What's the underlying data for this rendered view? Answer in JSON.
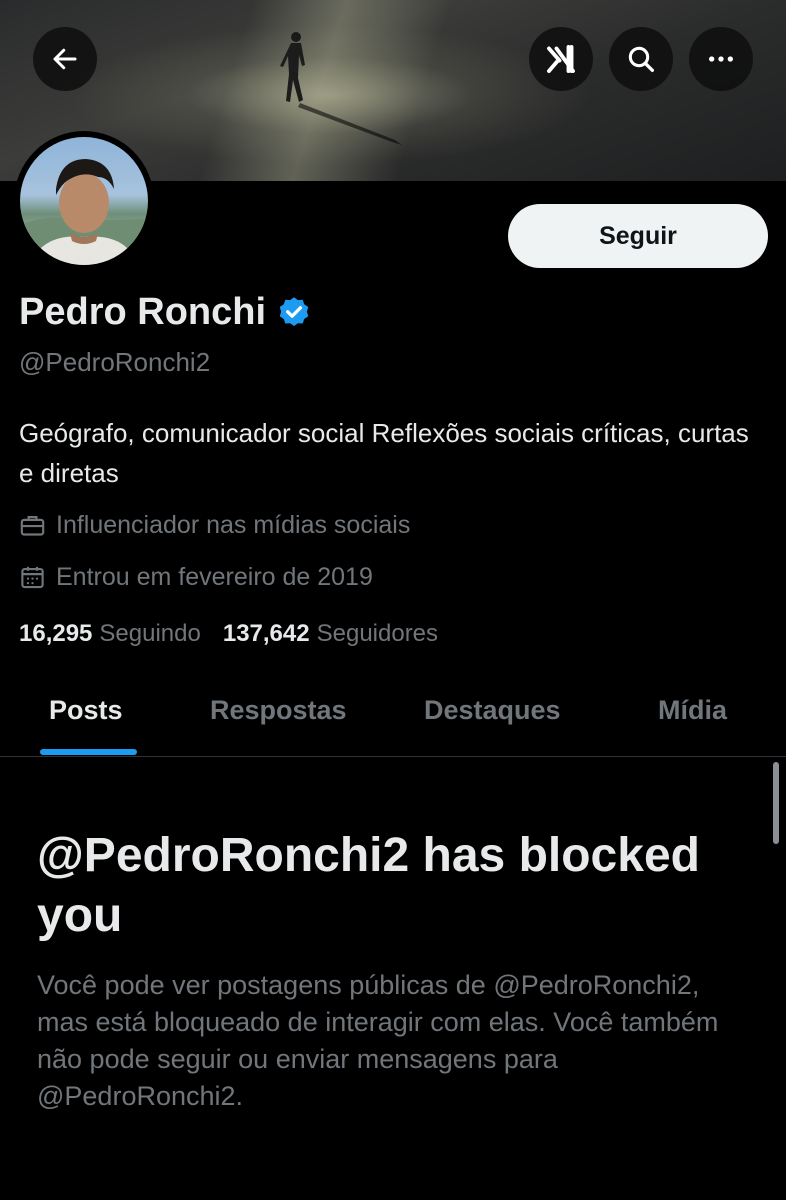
{
  "header": {
    "back_icon": "arrow-left-icon",
    "grok_icon": "grok-icon",
    "search_icon": "search-icon",
    "more_icon": "more-horizontal-icon"
  },
  "profile": {
    "follow_label": "Seguir",
    "name": "Pedro Ronchi",
    "verified_icon": "verified-badge-icon",
    "verified_color": "#1d9bf0",
    "handle": "@PedroRonchi2",
    "bio": "Geógrafo, comunicador social Reflexões sociais críticas, curtas e diretas",
    "category": "Influenciador nas mídias sociais",
    "joined": "Entrou em fevereiro de 2019",
    "following_count": "16,295",
    "following_label": "Seguindo",
    "followers_count": "137,642",
    "followers_label": "Seguidores"
  },
  "tabs": [
    {
      "label": "Posts",
      "active": true
    },
    {
      "label": "Respostas",
      "active": false
    },
    {
      "label": "Destaques",
      "active": false
    },
    {
      "label": "Mídia",
      "active": false
    }
  ],
  "blocked": {
    "title": "@PedroRonchi2 has blocked you",
    "description": "Você pode ver postagens públicas de @PedroRonchi2, mas está bloqueado de interagir com elas. Você também não pode seguir ou enviar mensagens para @PedroRonchi2."
  },
  "colors": {
    "accent": "#1d9bf0",
    "background": "#000000",
    "text_primary": "#e7e9ea",
    "text_secondary": "#71767b"
  }
}
